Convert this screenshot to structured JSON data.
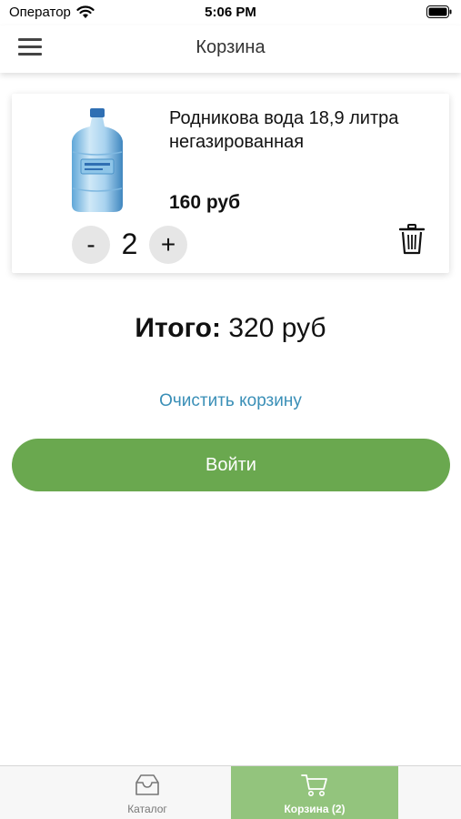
{
  "status_bar": {
    "carrier": "Оператор",
    "time": "5:06 PM"
  },
  "nav": {
    "title": "Корзина",
    "menu_icon": "hamburger-menu-icon"
  },
  "cart": {
    "items": [
      {
        "name": "Родникова вода 18,9 литра негазированная",
        "price": "160 руб",
        "quantity": "2",
        "decrement_label": "-",
        "increment_label": "+",
        "image": "water-bottle-image",
        "delete_icon": "trash-icon"
      }
    ],
    "total_label": "Итого:",
    "total_value": "320 руб",
    "clear_label": "Очистить корзину",
    "login_label": "Войти"
  },
  "tab_bar": {
    "tabs": [
      {
        "label": "Каталог",
        "icon": "inbox-tray-icon",
        "active": false
      },
      {
        "label": "Корзина (2)",
        "icon": "shopping-cart-icon",
        "active": true
      }
    ]
  },
  "colors": {
    "accent_green": "#6aa84f",
    "active_tab": "#93c47d",
    "link_blue": "#3a8fb7"
  }
}
